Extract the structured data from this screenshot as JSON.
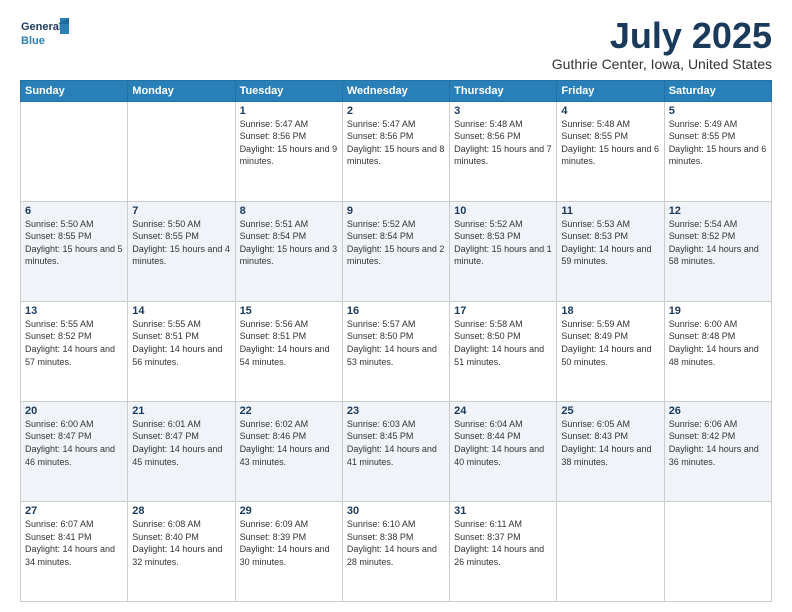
{
  "logo": {
    "line1": "General",
    "line2": "Blue"
  },
  "title": "July 2025",
  "subtitle": "Guthrie Center, Iowa, United States",
  "weekdays": [
    "Sunday",
    "Monday",
    "Tuesday",
    "Wednesday",
    "Thursday",
    "Friday",
    "Saturday"
  ],
  "weeks": [
    [
      {
        "day": "",
        "info": ""
      },
      {
        "day": "",
        "info": ""
      },
      {
        "day": "1",
        "info": "Sunrise: 5:47 AM\nSunset: 8:56 PM\nDaylight: 15 hours and 9 minutes."
      },
      {
        "day": "2",
        "info": "Sunrise: 5:47 AM\nSunset: 8:56 PM\nDaylight: 15 hours and 8 minutes."
      },
      {
        "day": "3",
        "info": "Sunrise: 5:48 AM\nSunset: 8:56 PM\nDaylight: 15 hours and 7 minutes."
      },
      {
        "day": "4",
        "info": "Sunrise: 5:48 AM\nSunset: 8:55 PM\nDaylight: 15 hours and 6 minutes."
      },
      {
        "day": "5",
        "info": "Sunrise: 5:49 AM\nSunset: 8:55 PM\nDaylight: 15 hours and 6 minutes."
      }
    ],
    [
      {
        "day": "6",
        "info": "Sunrise: 5:50 AM\nSunset: 8:55 PM\nDaylight: 15 hours and 5 minutes."
      },
      {
        "day": "7",
        "info": "Sunrise: 5:50 AM\nSunset: 8:55 PM\nDaylight: 15 hours and 4 minutes."
      },
      {
        "day": "8",
        "info": "Sunrise: 5:51 AM\nSunset: 8:54 PM\nDaylight: 15 hours and 3 minutes."
      },
      {
        "day": "9",
        "info": "Sunrise: 5:52 AM\nSunset: 8:54 PM\nDaylight: 15 hours and 2 minutes."
      },
      {
        "day": "10",
        "info": "Sunrise: 5:52 AM\nSunset: 8:53 PM\nDaylight: 15 hours and 1 minute."
      },
      {
        "day": "11",
        "info": "Sunrise: 5:53 AM\nSunset: 8:53 PM\nDaylight: 14 hours and 59 minutes."
      },
      {
        "day": "12",
        "info": "Sunrise: 5:54 AM\nSunset: 8:52 PM\nDaylight: 14 hours and 58 minutes."
      }
    ],
    [
      {
        "day": "13",
        "info": "Sunrise: 5:55 AM\nSunset: 8:52 PM\nDaylight: 14 hours and 57 minutes."
      },
      {
        "day": "14",
        "info": "Sunrise: 5:55 AM\nSunset: 8:51 PM\nDaylight: 14 hours and 56 minutes."
      },
      {
        "day": "15",
        "info": "Sunrise: 5:56 AM\nSunset: 8:51 PM\nDaylight: 14 hours and 54 minutes."
      },
      {
        "day": "16",
        "info": "Sunrise: 5:57 AM\nSunset: 8:50 PM\nDaylight: 14 hours and 53 minutes."
      },
      {
        "day": "17",
        "info": "Sunrise: 5:58 AM\nSunset: 8:50 PM\nDaylight: 14 hours and 51 minutes."
      },
      {
        "day": "18",
        "info": "Sunrise: 5:59 AM\nSunset: 8:49 PM\nDaylight: 14 hours and 50 minutes."
      },
      {
        "day": "19",
        "info": "Sunrise: 6:00 AM\nSunset: 8:48 PM\nDaylight: 14 hours and 48 minutes."
      }
    ],
    [
      {
        "day": "20",
        "info": "Sunrise: 6:00 AM\nSunset: 8:47 PM\nDaylight: 14 hours and 46 minutes."
      },
      {
        "day": "21",
        "info": "Sunrise: 6:01 AM\nSunset: 8:47 PM\nDaylight: 14 hours and 45 minutes."
      },
      {
        "day": "22",
        "info": "Sunrise: 6:02 AM\nSunset: 8:46 PM\nDaylight: 14 hours and 43 minutes."
      },
      {
        "day": "23",
        "info": "Sunrise: 6:03 AM\nSunset: 8:45 PM\nDaylight: 14 hours and 41 minutes."
      },
      {
        "day": "24",
        "info": "Sunrise: 6:04 AM\nSunset: 8:44 PM\nDaylight: 14 hours and 40 minutes."
      },
      {
        "day": "25",
        "info": "Sunrise: 6:05 AM\nSunset: 8:43 PM\nDaylight: 14 hours and 38 minutes."
      },
      {
        "day": "26",
        "info": "Sunrise: 6:06 AM\nSunset: 8:42 PM\nDaylight: 14 hours and 36 minutes."
      }
    ],
    [
      {
        "day": "27",
        "info": "Sunrise: 6:07 AM\nSunset: 8:41 PM\nDaylight: 14 hours and 34 minutes."
      },
      {
        "day": "28",
        "info": "Sunrise: 6:08 AM\nSunset: 8:40 PM\nDaylight: 14 hours and 32 minutes."
      },
      {
        "day": "29",
        "info": "Sunrise: 6:09 AM\nSunset: 8:39 PM\nDaylight: 14 hours and 30 minutes."
      },
      {
        "day": "30",
        "info": "Sunrise: 6:10 AM\nSunset: 8:38 PM\nDaylight: 14 hours and 28 minutes."
      },
      {
        "day": "31",
        "info": "Sunrise: 6:11 AM\nSunset: 8:37 PM\nDaylight: 14 hours and 26 minutes."
      },
      {
        "day": "",
        "info": ""
      },
      {
        "day": "",
        "info": ""
      }
    ]
  ]
}
